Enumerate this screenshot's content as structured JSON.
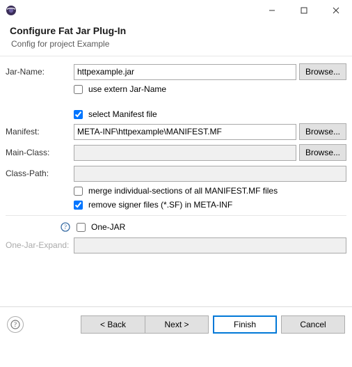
{
  "window": {
    "minimize": "—",
    "maximize": "□",
    "close": "✕"
  },
  "banner": {
    "title": "Configure Fat Jar Plug-In",
    "subtitle": "Config for project Example"
  },
  "labels": {
    "jar_name": "Jar-Name:",
    "manifest": "Manifest:",
    "main_class": "Main-Class:",
    "class_path": "Class-Path:",
    "one_jar_expand": "One-Jar-Expand:"
  },
  "values": {
    "jar_name": "httpexample.jar",
    "manifest": "META-INF\\httpexample\\MANIFEST.MF",
    "main_class": "",
    "class_path": "",
    "one_jar_expand": ""
  },
  "checkboxes": {
    "use_extern_jar_name": "use extern Jar-Name",
    "select_manifest_file": "select Manifest file",
    "merge_sections": "merge individual-sections of all MANIFEST.MF files",
    "remove_signer": "remove signer files (*.SF) in META-INF",
    "one_jar": "One-JAR"
  },
  "buttons": {
    "browse": "Browse...",
    "back": "< Back",
    "next": "Next >",
    "finish": "Finish",
    "cancel": "Cancel"
  }
}
